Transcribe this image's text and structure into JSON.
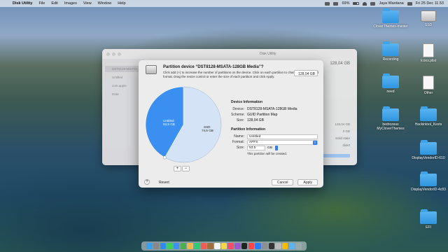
{
  "menubar": {
    "apple": "",
    "app_name": "Disk Utility",
    "items": [
      "File",
      "Edit",
      "Images",
      "View",
      "Window",
      "Help"
    ],
    "battery": "69%",
    "user": "Jaya Wardana",
    "clock": "Fri 25 Dec  11.53"
  },
  "background_window": {
    "title": "Disk Utility",
    "sidebar": [
      "DST8128-MSATA-",
      "Untitled",
      "com.apple",
      "Data"
    ],
    "capacity": "128,04 GB",
    "readouts": [
      "128,04 GB",
      "0 GB",
      "Solid state",
      "disk0"
    ]
  },
  "dialog": {
    "heading": "Partition device “DST8128-MSATA-128GB Media”?",
    "description": "Click add (+) to increase the number of partitions on the device. Click on each partition to change the name and format. Drag the resize control or enter the size of each partition and click Apply.",
    "device_size": "128,04 GB",
    "pie": {
      "untitled_label": "Untitled",
      "untitled_size": "53,5 GB",
      "ssd_label": "SSD",
      "ssd_size": "74,5 GB"
    },
    "device_info": {
      "title": "Device Information",
      "device_label": "Device:",
      "device_value": "DST8128-MSATA-128GB Media",
      "scheme_label": "Scheme:",
      "scheme_value": "GUID Partition Map",
      "size_label": "Size:",
      "size_value": "128,04 GB"
    },
    "partition_info": {
      "title": "Partition Information",
      "name_label": "Name:",
      "name_value": "Untitled",
      "format_label": "Format:",
      "format_value": "APFS",
      "size_label": "Size:",
      "size_value": "53,5",
      "size_unit": "GB",
      "note": "This partition will be created."
    },
    "buttons": {
      "add": "+",
      "remove": "−",
      "help": "?",
      "revert": "Revert",
      "cancel": "Cancel",
      "apply": "Apply"
    }
  },
  "desktop_icons": [
    {
      "label": "CloverThemes-master",
      "type": "folder"
    },
    {
      "label": "SSD",
      "type": "drive"
    },
    {
      "label": "Recording",
      "type": "folder"
    },
    {
      "label": "Icons.plist",
      "type": "document"
    },
    {
      "label": "need",
      "type": "folder"
    },
    {
      "label": "Other",
      "type": "document"
    },
    {
      "label": "bedrozeus MyCloverThemes",
      "type": "folder"
    },
    {
      "label": "Hackintool_Kexts",
      "type": "folder"
    },
    {
      "label": "DisplayVendorID-610",
      "type": "folder"
    },
    {
      "label": "DisplayVendorID-4c83",
      "type": "folder"
    },
    {
      "label": "EFI",
      "type": "folder"
    }
  ],
  "colors": {
    "accent": "#2f7df4",
    "pie_untitled": "#3b8ff0",
    "pie_ssd": "#dbe8f8",
    "folder": "#3ea3e8"
  },
  "dock_apps": [
    "finder-icon",
    "launchpad-icon",
    "safari-icon",
    "messages-icon",
    "mail-icon",
    "maps-icon",
    "photos-icon",
    "facetime-icon",
    "calendar-icon",
    "contacts-icon",
    "reminders-icon",
    "notes-icon",
    "music-icon",
    "podcasts-icon",
    "tv-icon",
    "news-icon",
    "appstore-icon",
    "settings-icon",
    "terminal-icon",
    "diskutility-icon",
    "chrome-icon",
    "folder-icon",
    "trash-icon"
  ]
}
